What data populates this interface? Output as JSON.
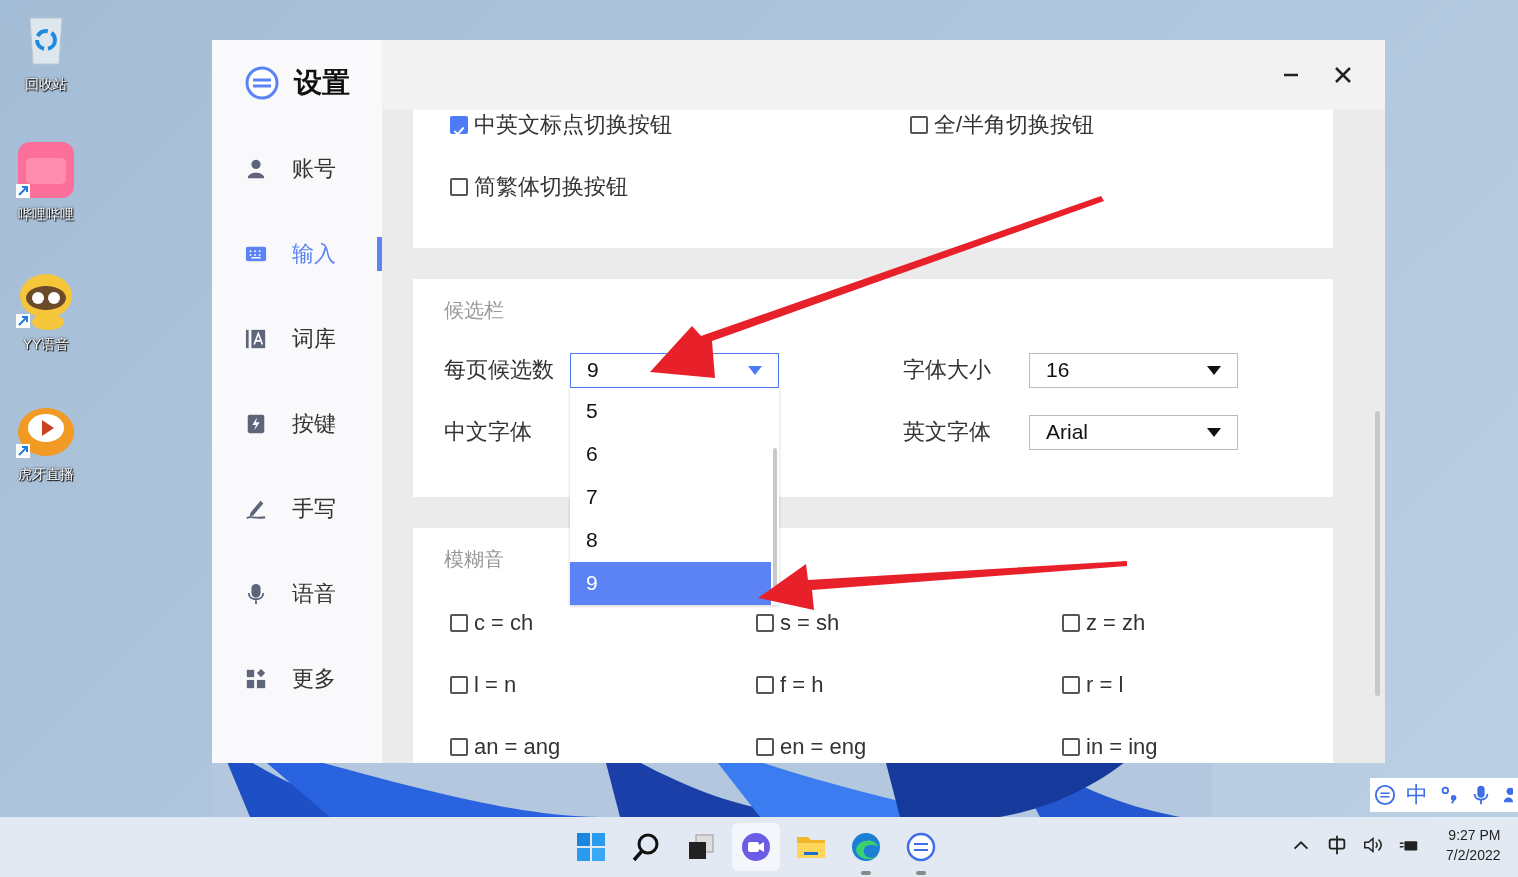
{
  "desktop_icons": [
    {
      "label": "回收站"
    },
    {
      "label": "哔哩哔哩"
    },
    {
      "label": "YY语音"
    },
    {
      "label": "虎牙直播"
    }
  ],
  "window": {
    "title": "设置",
    "sidebar": {
      "items": [
        {
          "label": "账号",
          "selected": false
        },
        {
          "label": "输入",
          "selected": true
        },
        {
          "label": "词库",
          "selected": false
        },
        {
          "label": "按键",
          "selected": false
        },
        {
          "label": "手写",
          "selected": false
        },
        {
          "label": "语音",
          "selected": false
        },
        {
          "label": "更多",
          "selected": false
        }
      ]
    },
    "toggles": [
      {
        "label": "中英文标点切换按钮",
        "checked": true
      },
      {
        "label": "全/半角切换按钮",
        "checked": false
      },
      {
        "label": "简繁体切换按钮",
        "checked": false
      }
    ],
    "candidate_bar": {
      "title": "候选栏",
      "fields": [
        {
          "label": "每页候选数",
          "value": "9",
          "open": true,
          "options": [
            {
              "label": "5",
              "selected": false
            },
            {
              "label": "6",
              "selected": false
            },
            {
              "label": "7",
              "selected": false
            },
            {
              "label": "8",
              "selected": false
            },
            {
              "label": "9",
              "selected": true
            }
          ]
        },
        {
          "label": "字体大小",
          "value": "16",
          "open": false
        },
        {
          "label": "中文字体"
        },
        {
          "label": "英文字体",
          "value": "Arial",
          "open": false
        }
      ]
    },
    "fuzzy_sounds": {
      "title": "模糊音",
      "options": [
        {
          "label": "c = ch",
          "checked": false
        },
        {
          "label": "s = sh",
          "checked": false
        },
        {
          "label": "z = zh",
          "checked": false
        },
        {
          "label": "l = n",
          "checked": false
        },
        {
          "label": "f = h",
          "checked": false
        },
        {
          "label": "r = l",
          "checked": false
        },
        {
          "label": "an = ang",
          "checked": false
        },
        {
          "label": "en = eng",
          "checked": false
        },
        {
          "label": "in = ing",
          "checked": false
        }
      ]
    }
  },
  "ime_bar": {
    "mode": "中"
  },
  "taskbar": {
    "apps": [
      {
        "selected": false,
        "running": false
      },
      {
        "selected": false,
        "running": false
      },
      {
        "selected": false,
        "running": false
      },
      {
        "selected": true,
        "running": false
      },
      {
        "selected": false,
        "running": false
      },
      {
        "selected": false,
        "running": true
      },
      {
        "selected": false,
        "running": true
      }
    ],
    "time": "9:27 PM",
    "date": "7/2/2022"
  }
}
